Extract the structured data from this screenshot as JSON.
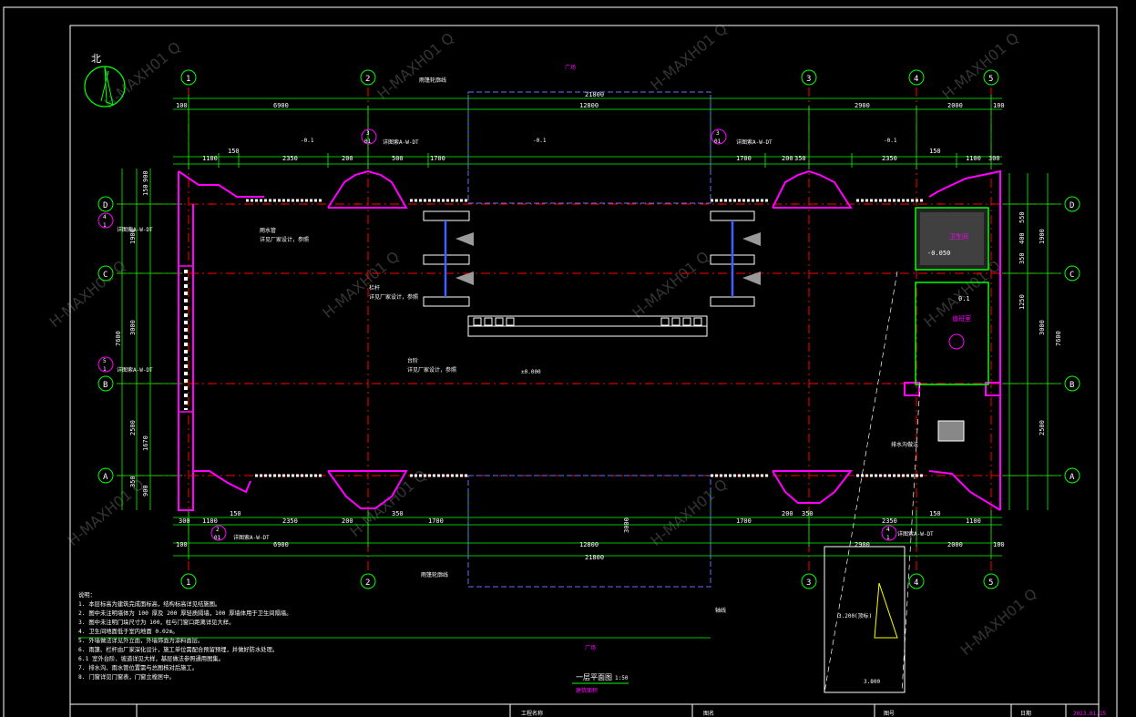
{
  "north_label": "北",
  "top_label": "广场",
  "bottom_label": "广场",
  "axis": {
    "numbers": [
      "1",
      "2",
      "3",
      "4",
      "5"
    ],
    "letters": [
      "D",
      "C",
      "B",
      "A"
    ]
  },
  "dims_top": {
    "outer_segments": [
      "6900",
      "12800",
      "2900",
      "2000"
    ],
    "overall": "21800",
    "edge": "100",
    "fine": [
      "1100",
      "150",
      "2350",
      "200",
      "500",
      "1700",
      "1700",
      "200",
      "350",
      "2350",
      "150",
      "1100",
      "300"
    ]
  },
  "dims_bottom": {
    "outer_segments": [
      "6900",
      "12800",
      "2900",
      "2000"
    ],
    "overall": "21800",
    "edge": "100",
    "fine": [
      "300",
      "1100",
      "150",
      "2350",
      "200",
      "350",
      "1700",
      "1700",
      "200",
      "350",
      "2350",
      "150",
      "1100"
    ],
    "depth": "3000"
  },
  "dims_left": [
    "150",
    "900",
    "1900",
    "3000",
    "2500",
    "1670",
    "350",
    "900",
    "7600"
  ],
  "dims_right": [
    "1900",
    "3000",
    "2500",
    "7600",
    "550",
    "400",
    "350",
    "1250"
  ],
  "labels": {
    "canopy": "雨篷轮廓线",
    "canopy_bottom": "雨篷轮廓线",
    "rail": "栏杆",
    "rail_note": "详见厂家设计，参照",
    "step": "台阶",
    "level_main": "±0.000",
    "level_a": "-0.1",
    "level_b": "-0.1",
    "level_c": "-0.1",
    "level_d": "-0.1",
    "level_e": "0.1",
    "level_f": "-0.050",
    "level_g": "3.200(顶标)",
    "level_h": "3.800",
    "ref_a": "详图索A-W-DT",
    "ref_b": "详图索A-W-DT",
    "ref_c": "详图索A-W-DT",
    "ref_d": "详图索A-W-DT",
    "ref_e": "详图索A-W-DT",
    "room_wc": "卫生间",
    "room_duty": "值班室",
    "drain": "排水沟做法",
    "drain2": "雨水管",
    "note_arrow": "轴线",
    "mark_1": "1",
    "mark_2": "2",
    "mark_01": "01",
    "mark_3": "3",
    "mark_4": "4",
    "mark_5": "5"
  },
  "notes": {
    "heading": "说明：",
    "items": [
      "1. 本层标高为建筑完成面标高，结构标高详见结施图。",
      "2. 图中未注明墙体为 100 厚及 200 厚轻质隔墙，100 厚墙体用于卫生间隔墙。",
      "3. 图中未注明门垛尺寸为 100，柱与门窗口距离详见大样。",
      "4. 卫生间地面低于室内地面 0.02m。",
      "5. 外墙做法详见外立面，外墙饰面为涂料面层。",
      "6. 雨篷、栏杆由厂家深化设计，施工单位需配合预留预埋，并做好防水处理。",
      "6.1 室外台阶、坡道详见大样，基层做法参照通用图集。",
      "7. 排水沟、雨水管位置需与总图核对后施工。",
      "8. 门窗详见门窗表，门窗立樘居中。"
    ]
  },
  "drawing_title": "一层平面图",
  "drawing_scale": "1:50",
  "drawing_sub": "建筑面积",
  "titleblock": {
    "c1": "工程名称",
    "c2": "图名",
    "c3": "图号",
    "c4": "日期",
    "c5": "2023.01.15"
  },
  "watermark": "H-MAXH01  Q",
  "colors": {
    "background": "#000000",
    "dimension": "#00ff00",
    "wall": "#ff00ff",
    "axis_line": "#ff0000",
    "text": "#ffffff",
    "frame": "#ffffff",
    "canopy": "#6a6aff",
    "door": "#3f5fff"
  }
}
